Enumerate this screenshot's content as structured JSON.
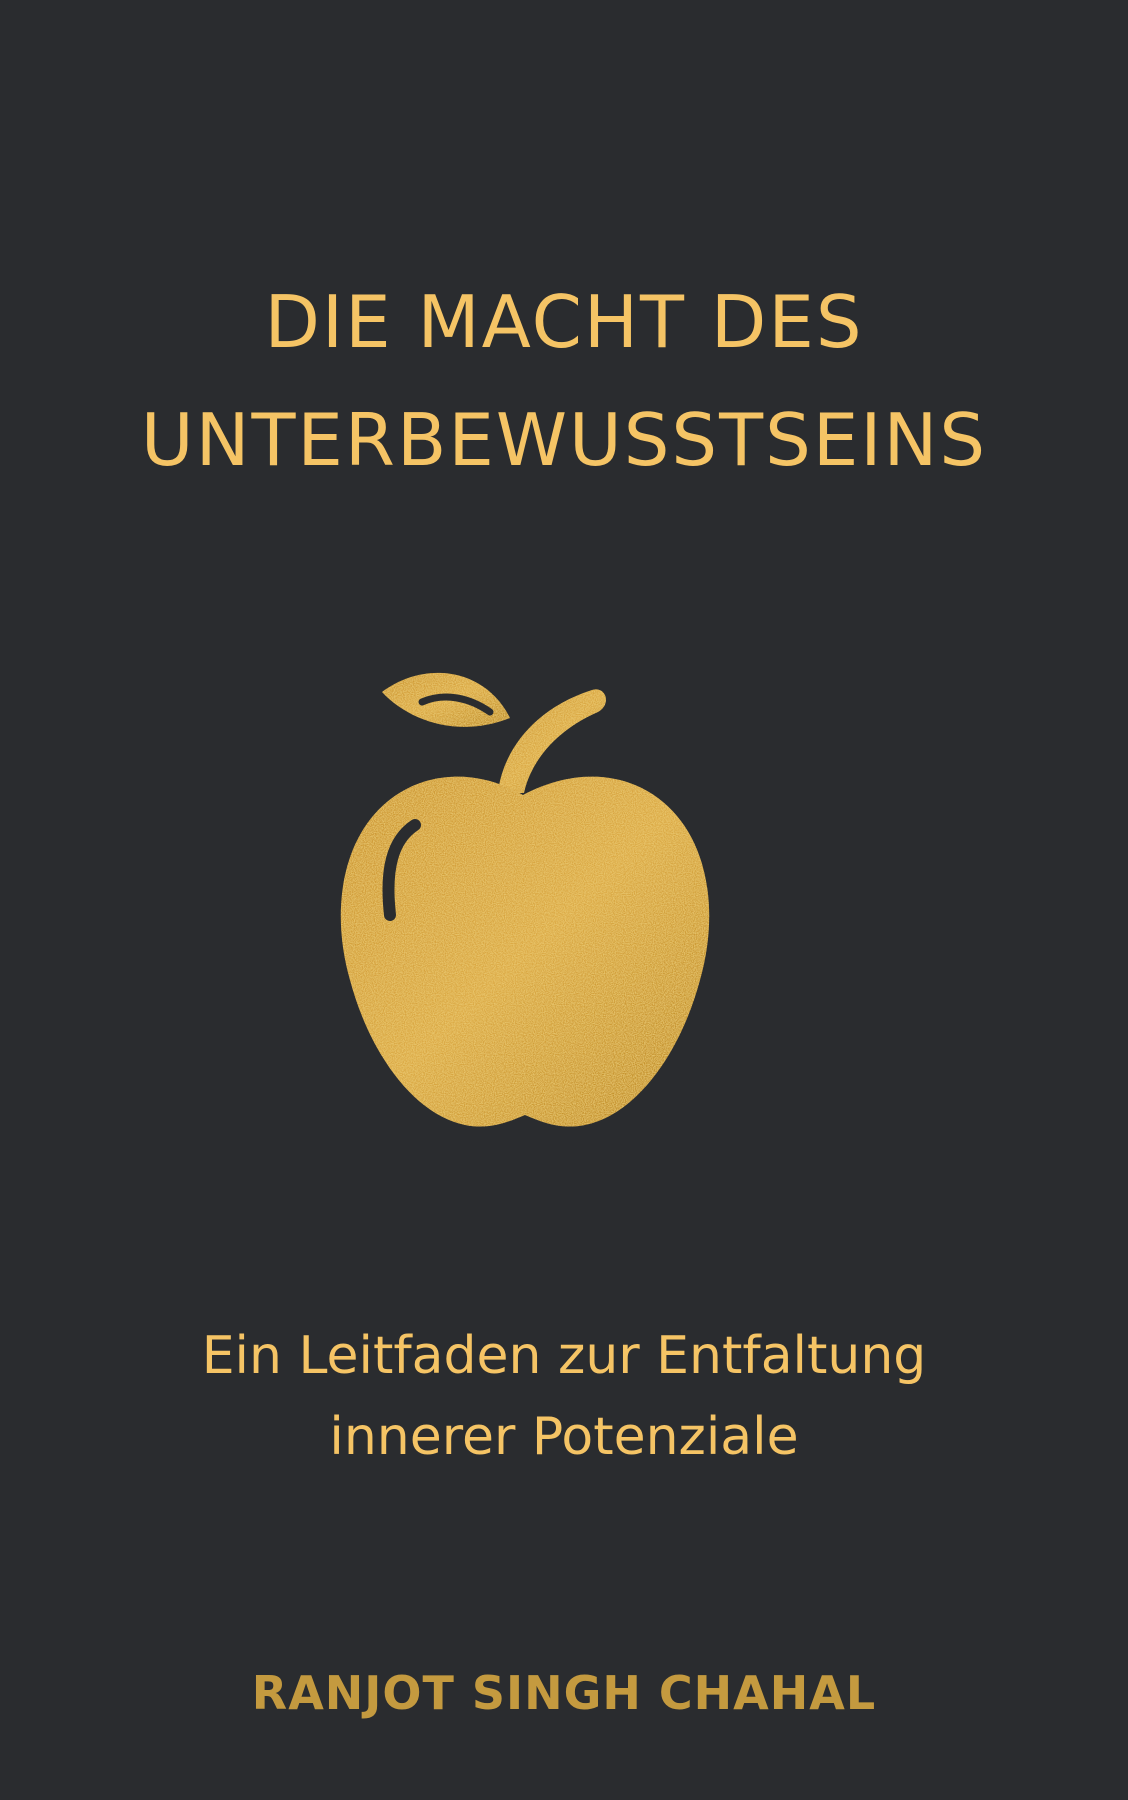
{
  "cover": {
    "title_lines": [
      "DIE MACHT DES",
      "UNTERBEWUSSTSEINS"
    ],
    "subtitle_lines": [
      "Ein Leitfaden zur Entfaltung",
      "innerer Potenziale"
    ],
    "author": "RANJOT SINGH CHAHAL",
    "illustration": "apple-icon",
    "colors": {
      "background": "#2a2c2f",
      "title": "#f5c465",
      "author": "#c49a3f",
      "gold": "#d9a63a"
    }
  }
}
